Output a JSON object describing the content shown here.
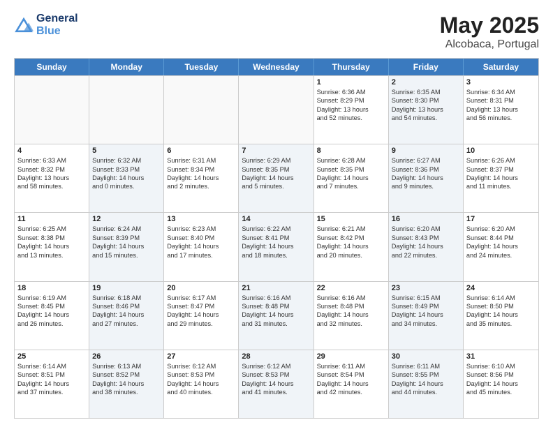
{
  "header": {
    "logo_general": "General",
    "logo_blue": "Blue",
    "title": "May 2025",
    "subtitle": "Alcobaca, Portugal"
  },
  "days_of_week": [
    "Sunday",
    "Monday",
    "Tuesday",
    "Wednesday",
    "Thursday",
    "Friday",
    "Saturday"
  ],
  "weeks": [
    [
      {
        "day": "",
        "sunrise": "",
        "sunset": "",
        "daylight": "",
        "shaded": false,
        "empty": true
      },
      {
        "day": "",
        "sunrise": "",
        "sunset": "",
        "daylight": "",
        "shaded": false,
        "empty": true
      },
      {
        "day": "",
        "sunrise": "",
        "sunset": "",
        "daylight": "",
        "shaded": false,
        "empty": true
      },
      {
        "day": "",
        "sunrise": "",
        "sunset": "",
        "daylight": "",
        "shaded": false,
        "empty": true
      },
      {
        "day": "1",
        "sunrise": "Sunrise: 6:36 AM",
        "sunset": "Sunset: 8:29 PM",
        "daylight": "Daylight: 13 hours and 52 minutes.",
        "shaded": false,
        "empty": false
      },
      {
        "day": "2",
        "sunrise": "Sunrise: 6:35 AM",
        "sunset": "Sunset: 8:30 PM",
        "daylight": "Daylight: 13 hours and 54 minutes.",
        "shaded": true,
        "empty": false
      },
      {
        "day": "3",
        "sunrise": "Sunrise: 6:34 AM",
        "sunset": "Sunset: 8:31 PM",
        "daylight": "Daylight: 13 hours and 56 minutes.",
        "shaded": false,
        "empty": false
      }
    ],
    [
      {
        "day": "4",
        "sunrise": "Sunrise: 6:33 AM",
        "sunset": "Sunset: 8:32 PM",
        "daylight": "Daylight: 13 hours and 58 minutes.",
        "shaded": false,
        "empty": false
      },
      {
        "day": "5",
        "sunrise": "Sunrise: 6:32 AM",
        "sunset": "Sunset: 8:33 PM",
        "daylight": "Daylight: 14 hours and 0 minutes.",
        "shaded": true,
        "empty": false
      },
      {
        "day": "6",
        "sunrise": "Sunrise: 6:31 AM",
        "sunset": "Sunset: 8:34 PM",
        "daylight": "Daylight: 14 hours and 2 minutes.",
        "shaded": false,
        "empty": false
      },
      {
        "day": "7",
        "sunrise": "Sunrise: 6:29 AM",
        "sunset": "Sunset: 8:35 PM",
        "daylight": "Daylight: 14 hours and 5 minutes.",
        "shaded": true,
        "empty": false
      },
      {
        "day": "8",
        "sunrise": "Sunrise: 6:28 AM",
        "sunset": "Sunset: 8:35 PM",
        "daylight": "Daylight: 14 hours and 7 minutes.",
        "shaded": false,
        "empty": false
      },
      {
        "day": "9",
        "sunrise": "Sunrise: 6:27 AM",
        "sunset": "Sunset: 8:36 PM",
        "daylight": "Daylight: 14 hours and 9 minutes.",
        "shaded": true,
        "empty": false
      },
      {
        "day": "10",
        "sunrise": "Sunrise: 6:26 AM",
        "sunset": "Sunset: 8:37 PM",
        "daylight": "Daylight: 14 hours and 11 minutes.",
        "shaded": false,
        "empty": false
      }
    ],
    [
      {
        "day": "11",
        "sunrise": "Sunrise: 6:25 AM",
        "sunset": "Sunset: 8:38 PM",
        "daylight": "Daylight: 14 hours and 13 minutes.",
        "shaded": false,
        "empty": false
      },
      {
        "day": "12",
        "sunrise": "Sunrise: 6:24 AM",
        "sunset": "Sunset: 8:39 PM",
        "daylight": "Daylight: 14 hours and 15 minutes.",
        "shaded": true,
        "empty": false
      },
      {
        "day": "13",
        "sunrise": "Sunrise: 6:23 AM",
        "sunset": "Sunset: 8:40 PM",
        "daylight": "Daylight: 14 hours and 17 minutes.",
        "shaded": false,
        "empty": false
      },
      {
        "day": "14",
        "sunrise": "Sunrise: 6:22 AM",
        "sunset": "Sunset: 8:41 PM",
        "daylight": "Daylight: 14 hours and 18 minutes.",
        "shaded": true,
        "empty": false
      },
      {
        "day": "15",
        "sunrise": "Sunrise: 6:21 AM",
        "sunset": "Sunset: 8:42 PM",
        "daylight": "Daylight: 14 hours and 20 minutes.",
        "shaded": false,
        "empty": false
      },
      {
        "day": "16",
        "sunrise": "Sunrise: 6:20 AM",
        "sunset": "Sunset: 8:43 PM",
        "daylight": "Daylight: 14 hours and 22 minutes.",
        "shaded": true,
        "empty": false
      },
      {
        "day": "17",
        "sunrise": "Sunrise: 6:20 AM",
        "sunset": "Sunset: 8:44 PM",
        "daylight": "Daylight: 14 hours and 24 minutes.",
        "shaded": false,
        "empty": false
      }
    ],
    [
      {
        "day": "18",
        "sunrise": "Sunrise: 6:19 AM",
        "sunset": "Sunset: 8:45 PM",
        "daylight": "Daylight: 14 hours and 26 minutes.",
        "shaded": false,
        "empty": false
      },
      {
        "day": "19",
        "sunrise": "Sunrise: 6:18 AM",
        "sunset": "Sunset: 8:46 PM",
        "daylight": "Daylight: 14 hours and 27 minutes.",
        "shaded": true,
        "empty": false
      },
      {
        "day": "20",
        "sunrise": "Sunrise: 6:17 AM",
        "sunset": "Sunset: 8:47 PM",
        "daylight": "Daylight: 14 hours and 29 minutes.",
        "shaded": false,
        "empty": false
      },
      {
        "day": "21",
        "sunrise": "Sunrise: 6:16 AM",
        "sunset": "Sunset: 8:48 PM",
        "daylight": "Daylight: 14 hours and 31 minutes.",
        "shaded": true,
        "empty": false
      },
      {
        "day": "22",
        "sunrise": "Sunrise: 6:16 AM",
        "sunset": "Sunset: 8:48 PM",
        "daylight": "Daylight: 14 hours and 32 minutes.",
        "shaded": false,
        "empty": false
      },
      {
        "day": "23",
        "sunrise": "Sunrise: 6:15 AM",
        "sunset": "Sunset: 8:49 PM",
        "daylight": "Daylight: 14 hours and 34 minutes.",
        "shaded": true,
        "empty": false
      },
      {
        "day": "24",
        "sunrise": "Sunrise: 6:14 AM",
        "sunset": "Sunset: 8:50 PM",
        "daylight": "Daylight: 14 hours and 35 minutes.",
        "shaded": false,
        "empty": false
      }
    ],
    [
      {
        "day": "25",
        "sunrise": "Sunrise: 6:14 AM",
        "sunset": "Sunset: 8:51 PM",
        "daylight": "Daylight: 14 hours and 37 minutes.",
        "shaded": false,
        "empty": false
      },
      {
        "day": "26",
        "sunrise": "Sunrise: 6:13 AM",
        "sunset": "Sunset: 8:52 PM",
        "daylight": "Daylight: 14 hours and 38 minutes.",
        "shaded": true,
        "empty": false
      },
      {
        "day": "27",
        "sunrise": "Sunrise: 6:12 AM",
        "sunset": "Sunset: 8:53 PM",
        "daylight": "Daylight: 14 hours and 40 minutes.",
        "shaded": false,
        "empty": false
      },
      {
        "day": "28",
        "sunrise": "Sunrise: 6:12 AM",
        "sunset": "Sunset: 8:53 PM",
        "daylight": "Daylight: 14 hours and 41 minutes.",
        "shaded": true,
        "empty": false
      },
      {
        "day": "29",
        "sunrise": "Sunrise: 6:11 AM",
        "sunset": "Sunset: 8:54 PM",
        "daylight": "Daylight: 14 hours and 42 minutes.",
        "shaded": false,
        "empty": false
      },
      {
        "day": "30",
        "sunrise": "Sunrise: 6:11 AM",
        "sunset": "Sunset: 8:55 PM",
        "daylight": "Daylight: 14 hours and 44 minutes.",
        "shaded": true,
        "empty": false
      },
      {
        "day": "31",
        "sunrise": "Sunrise: 6:10 AM",
        "sunset": "Sunset: 8:56 PM",
        "daylight": "Daylight: 14 hours and 45 minutes.",
        "shaded": false,
        "empty": false
      }
    ]
  ]
}
